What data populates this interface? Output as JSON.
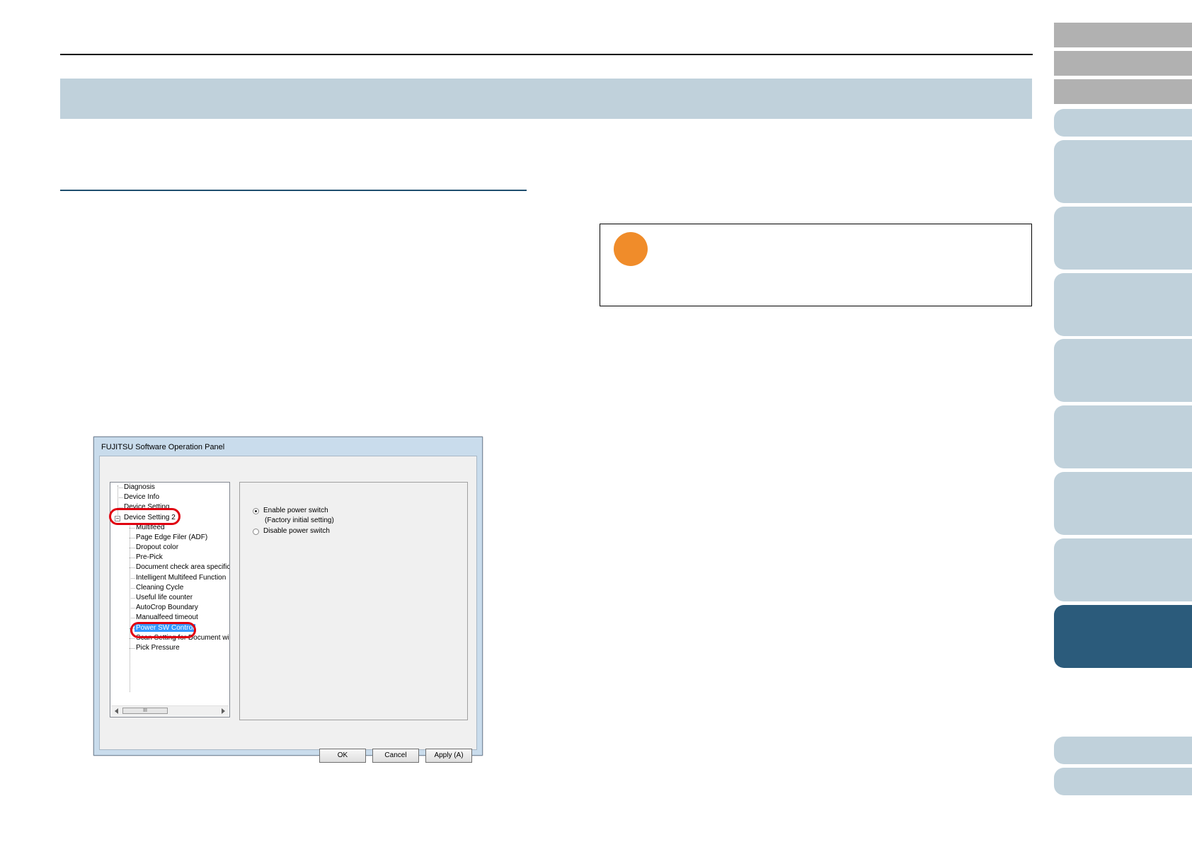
{
  "dialog": {
    "title": "FUJITSU Software Operation Panel",
    "tree": {
      "top_items": [
        "Diagnosis",
        "Device Info",
        "Device Setting"
      ],
      "expanded_item": "Device Setting 2",
      "expander_symbol": "−",
      "children": [
        "Multifeed",
        "Page Edge Filer (ADF)",
        "Dropout color",
        "Pre-Pick",
        "Document check area specific",
        "Intelligent Multifeed Function",
        "Cleaning Cycle",
        "Useful life counter",
        "AutoCrop Boundary",
        "Manualfeed timeout"
      ],
      "selected_item": "Power SW Control",
      "children_after": [
        "Scan Setting for Document wit",
        "Pick Pressure"
      ],
      "scrollbar_thumb": "III"
    },
    "options": {
      "enable_label": "Enable power switch",
      "enable_note": "(Factory initial setting)",
      "disable_label": "Disable power switch",
      "selected": "enable"
    },
    "buttons": {
      "ok": "OK",
      "cancel": "Cancel",
      "apply": "Apply (A)"
    }
  },
  "colors": {
    "title_band": "#c0d1db",
    "active_tab": "#2b5b7b",
    "note_marker": "#f08c2a",
    "highlight_ring": "#e00010",
    "selection": "#3399ff"
  }
}
